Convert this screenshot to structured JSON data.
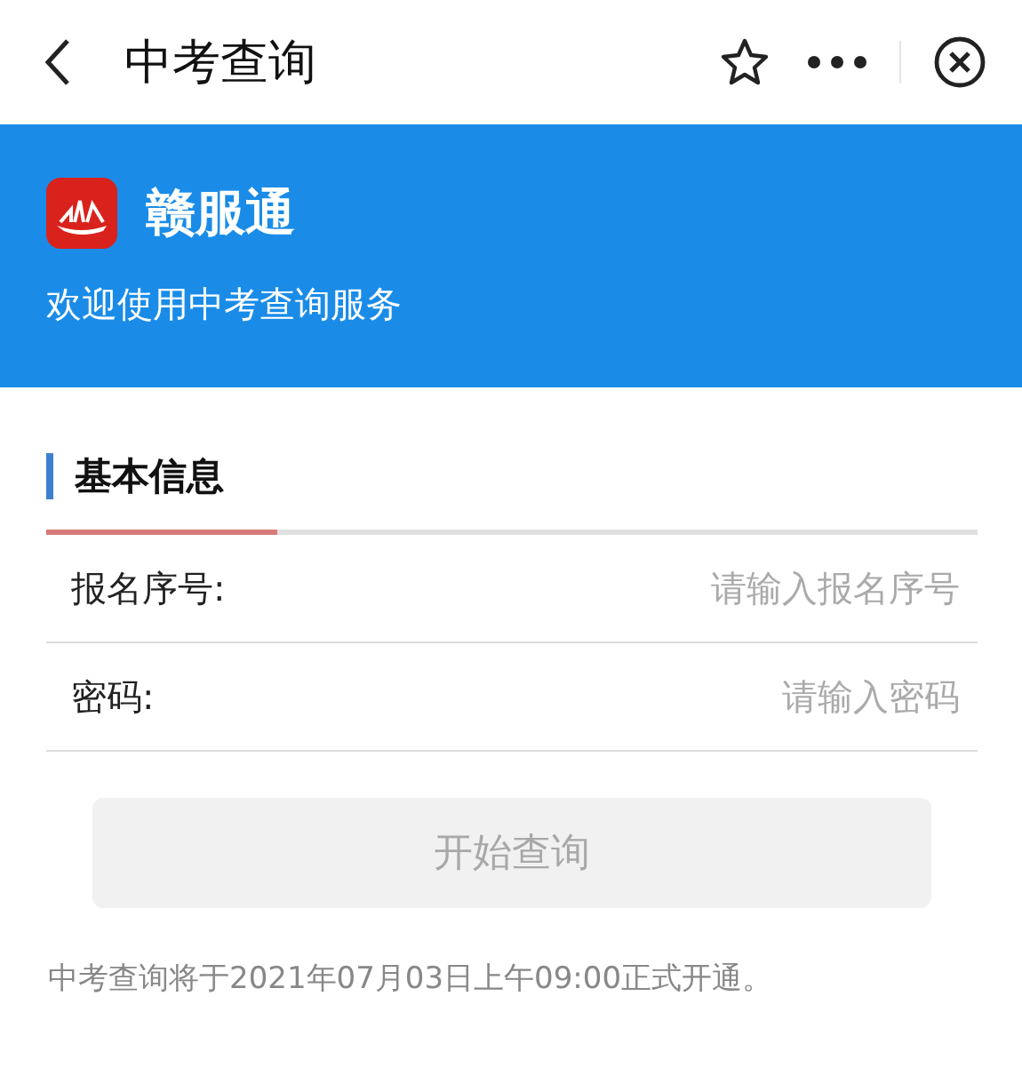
{
  "nav_bar": {
    "title": "中考查询"
  },
  "banner": {
    "app_name": "赣服通",
    "welcome": "欢迎使用中考查询服务"
  },
  "form": {
    "section_title": "基本信息",
    "fields": [
      {
        "label": "报名序号:",
        "placeholder": "请输入报名序号"
      },
      {
        "label": "密码:",
        "placeholder": "请输入密码"
      }
    ],
    "submit": {
      "label": "开始查询",
      "disabled": true
    }
  },
  "notice": "中考查询将于2021年07月03日上午09:00正式开通。"
}
